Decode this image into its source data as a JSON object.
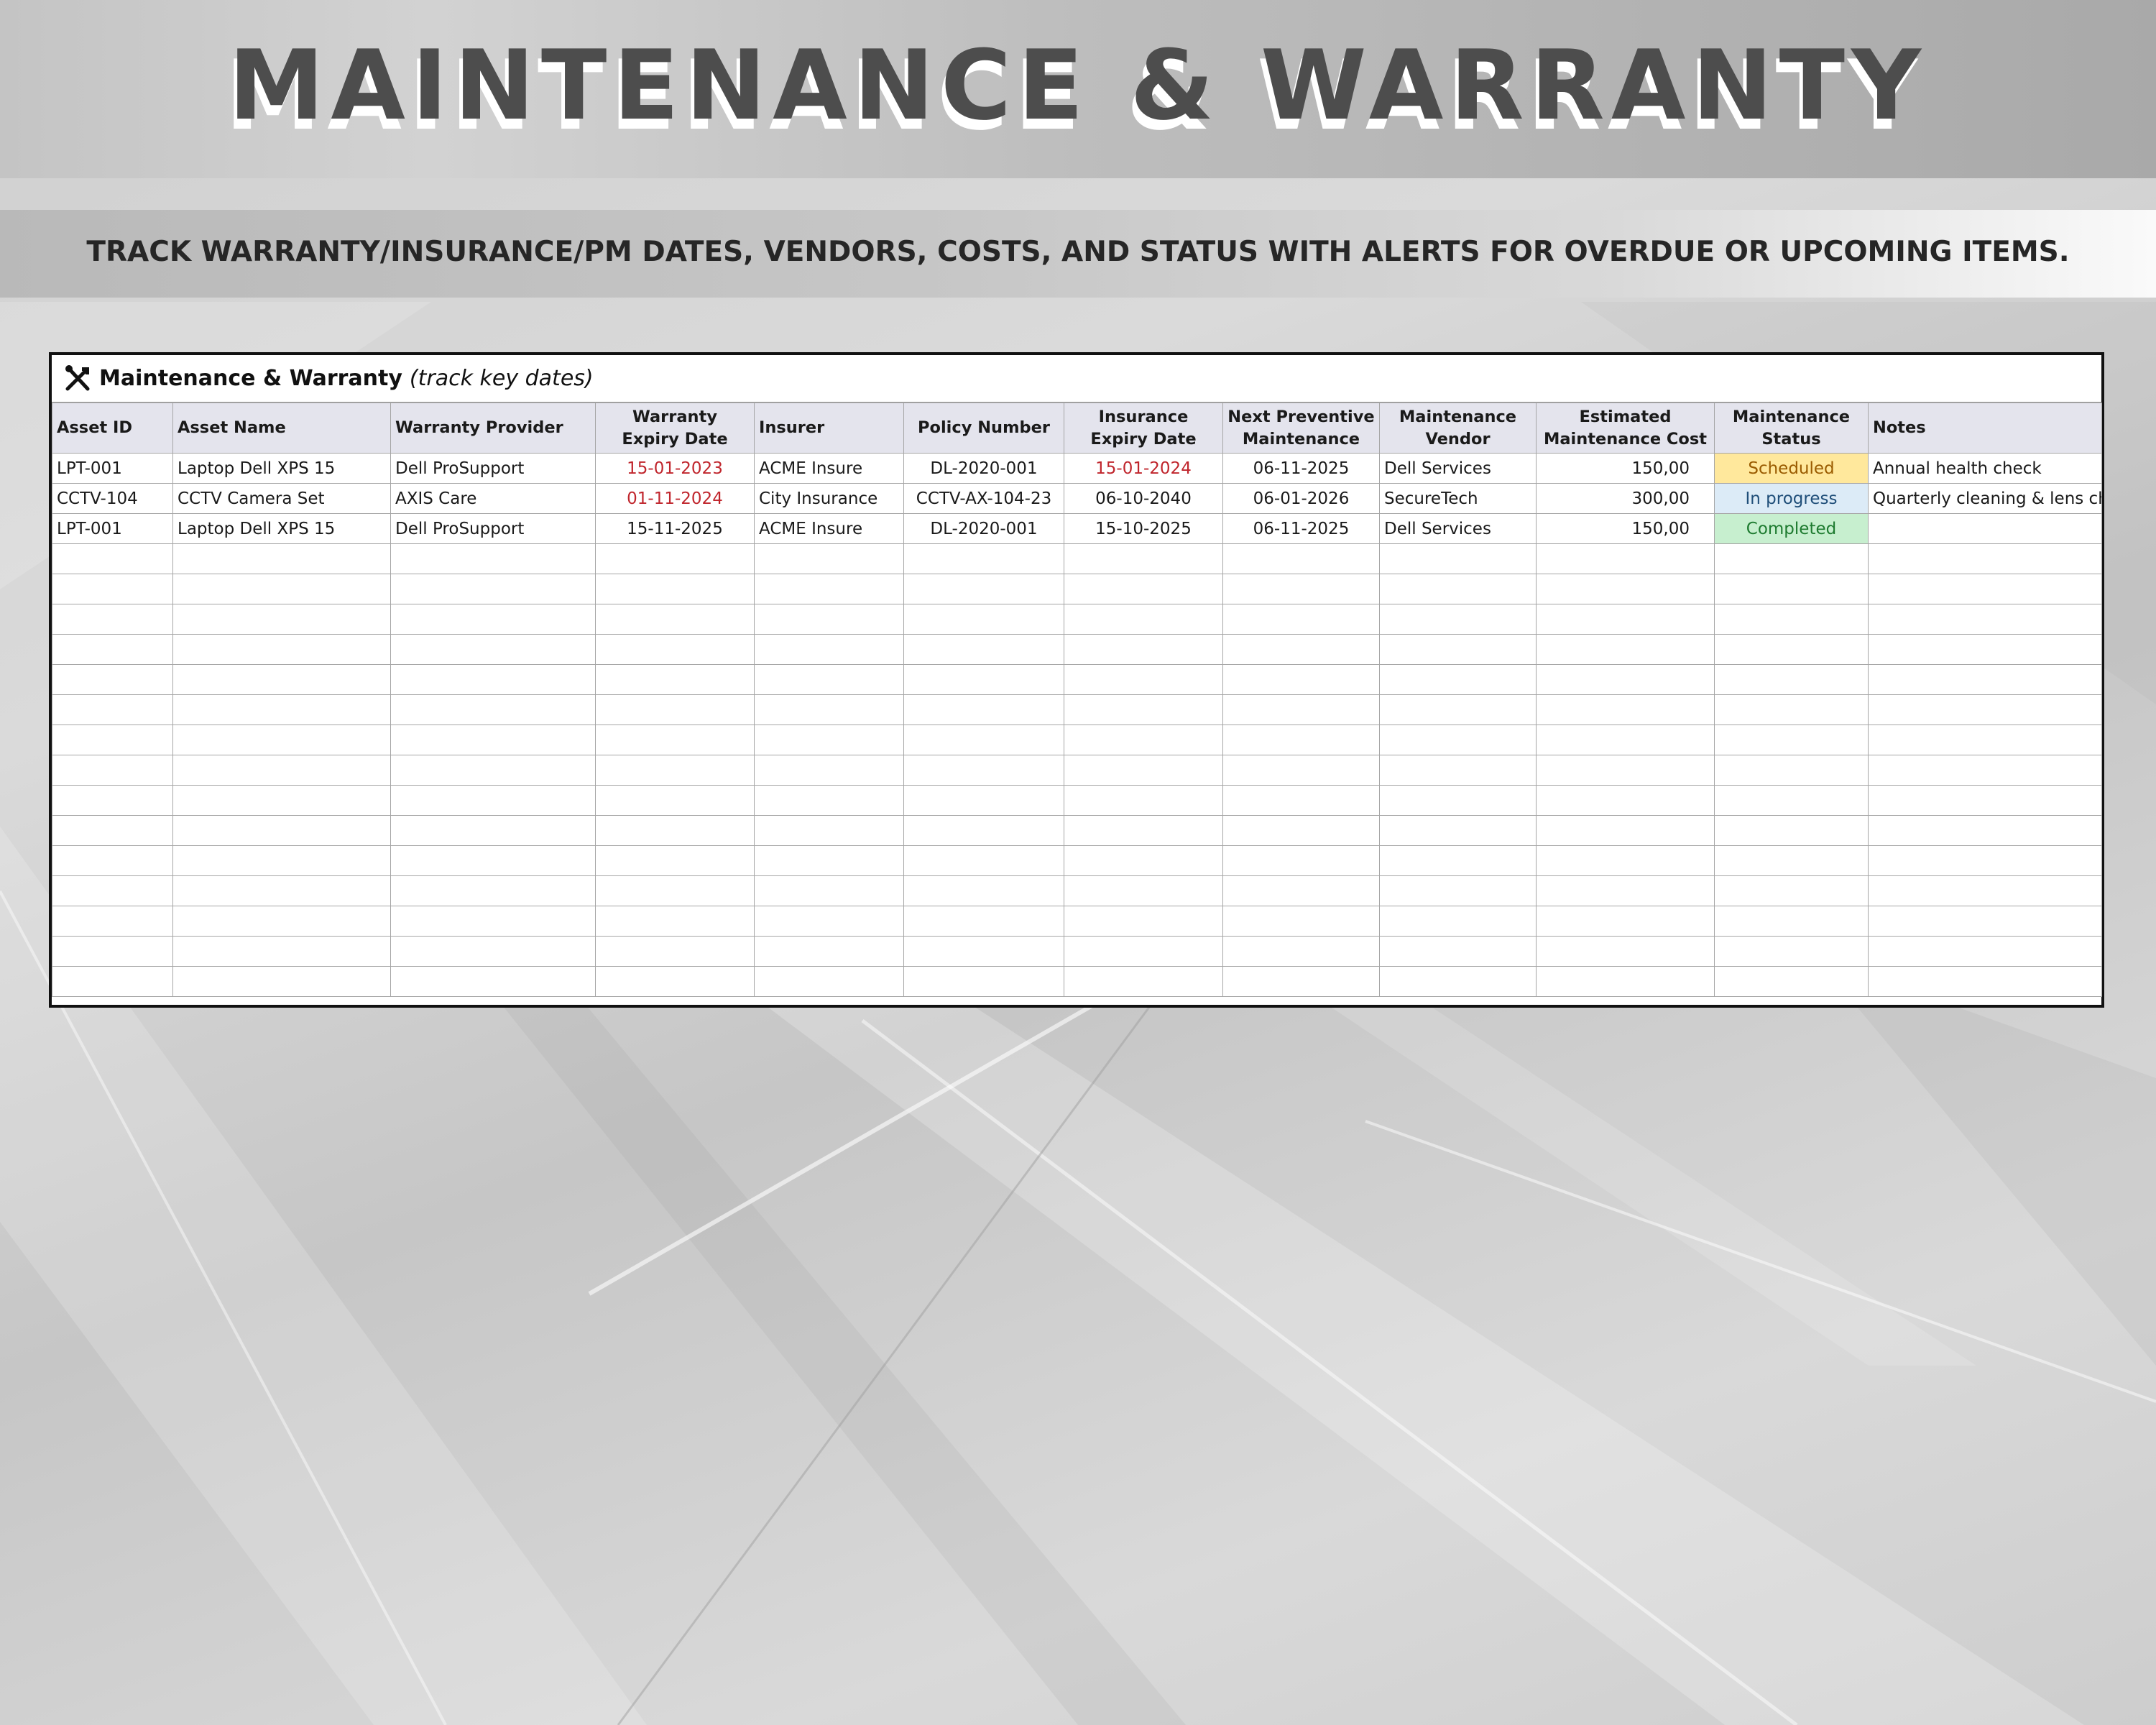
{
  "page": {
    "title": "MAINTENANCE & WARRANTY",
    "subtitle": "TRACK WARRANTY/INSURANCE/PM DATES, VENDORS, COSTS, AND STATUS WITH ALERTS FOR OVERDUE OR UPCOMING ITEMS."
  },
  "sheet": {
    "title": "Maintenance & Warranty",
    "title_note": "(track key dates)",
    "icon": "tools-icon",
    "headers": {
      "asset_id": "Asset ID",
      "asset_name": "Asset Name",
      "warranty_provider": "Warranty Provider",
      "warranty_expiry_1": "Warranty",
      "warranty_expiry_2": "Expiry Date",
      "insurer": "Insurer",
      "policy_number": "Policy Number",
      "insurance_expiry_1": "Insurance",
      "insurance_expiry_2": "Expiry Date",
      "next_pm_1": "Next Preventive",
      "next_pm_2": "Maintenance",
      "vendor_1": "Maintenance",
      "vendor_2": "Vendor",
      "cost_1": "Estimated",
      "cost_2": "Maintenance Cost",
      "status_1": "Maintenance",
      "status_2": "Status",
      "notes": "Notes"
    },
    "rows": [
      {
        "asset_id": "LPT-001",
        "asset_name": "Laptop Dell XPS 15",
        "warranty_provider": "Dell ProSupport",
        "warranty_expiry": "15-01-2023",
        "insurer": "ACME Insure",
        "policy_number": "DL-2020-001",
        "insurance_expiry": "15-01-2024",
        "next_pm": "06-11-2025",
        "vendor": "Dell Services",
        "cost": "150,00",
        "status": "Scheduled",
        "notes": "Annual health check"
      },
      {
        "asset_id": "CCTV-104",
        "asset_name": "CCTV Camera Set",
        "warranty_provider": "AXIS Care",
        "warranty_expiry": "01-11-2024",
        "insurer": "City Insurance",
        "policy_number": "CCTV-AX-104-23",
        "insurance_expiry": "06-10-2040",
        "next_pm": "06-01-2026",
        "vendor": "SecureTech",
        "cost": "300,00",
        "status": "In progress",
        "notes": "Quarterly cleaning & lens che"
      },
      {
        "asset_id": "LPT-001",
        "asset_name": "Laptop Dell XPS 15",
        "warranty_provider": "Dell ProSupport",
        "warranty_expiry": "15-11-2025",
        "insurer": "ACME Insure",
        "policy_number": "DL-2020-001",
        "insurance_expiry": "15-10-2025",
        "next_pm": "06-11-2025",
        "vendor": "Dell Services",
        "cost": "150,00",
        "status": "Completed",
        "notes": ""
      }
    ],
    "empty_row_count": 15,
    "colors": {
      "header_bg": "#e4e4ed",
      "overdue_text": "#c0262d",
      "scheduled_bg": "#ffe89c",
      "in_progress_bg": "#dcebf7",
      "completed_bg": "#c7efcf"
    }
  }
}
